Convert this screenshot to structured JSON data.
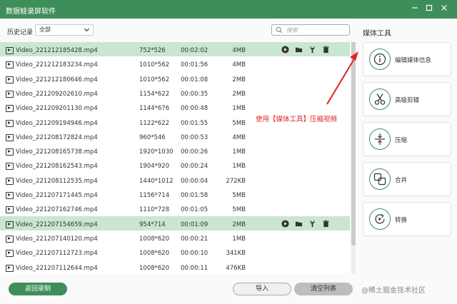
{
  "window": {
    "title": "数据蛙录屏软件",
    "controls": [
      "minimize",
      "maximize",
      "close"
    ]
  },
  "toolbar": {
    "history_label": "历史记录",
    "history_filter": "全部",
    "search_placeholder": "搜索"
  },
  "side_panel": {
    "title": "媒体工具",
    "tools": [
      {
        "label": "编辑媒体信息",
        "icon": "info-icon"
      },
      {
        "label": "高级剪辑",
        "icon": "scissors-icon"
      },
      {
        "label": "压缩",
        "icon": "compress-icon"
      },
      {
        "label": "合并",
        "icon": "merge-icon"
      },
      {
        "label": "转换",
        "icon": "convert-icon"
      }
    ]
  },
  "annotation": "使用【媒体工具】压缩视频",
  "records": [
    {
      "name": "Video_221212185428.mp4",
      "resolution": "752*526",
      "duration": "00:02:02",
      "size": "4MB",
      "selected": true
    },
    {
      "name": "Video_221212183234.mp4",
      "resolution": "1010*562",
      "duration": "00:01:56",
      "size": "4MB",
      "selected": false
    },
    {
      "name": "Video_221212180646.mp4",
      "resolution": "1010*562",
      "duration": "00:01:08",
      "size": "2MB",
      "selected": false
    },
    {
      "name": "Video_221209202610.mp4",
      "resolution": "1154*622",
      "duration": "00:00:35",
      "size": "2MB",
      "selected": false
    },
    {
      "name": "Video_221209201130.mp4",
      "resolution": "1144*676",
      "duration": "00:00:48",
      "size": "1MB",
      "selected": false
    },
    {
      "name": "Video_221209194946.mp4",
      "resolution": "1122*622",
      "duration": "00:01:55",
      "size": "5MB",
      "selected": false
    },
    {
      "name": "Video_221208172824.mp4",
      "resolution": "960*546",
      "duration": "00:00:53",
      "size": "4MB",
      "selected": false
    },
    {
      "name": "Video_221208165738.mp4",
      "resolution": "1920*1030",
      "duration": "00:00:26",
      "size": "1MB",
      "selected": false
    },
    {
      "name": "Video_221208162543.mp4",
      "resolution": "1904*920",
      "duration": "00:00:24",
      "size": "1MB",
      "selected": false
    },
    {
      "name": "Video_221208112535.mp4",
      "resolution": "1440*1012",
      "duration": "00:00:04",
      "size": "272KB",
      "selected": false
    },
    {
      "name": "Video_221207171445.mp4",
      "resolution": "1156*714",
      "duration": "00:01:58",
      "size": "5MB",
      "selected": false
    },
    {
      "name": "Video_221207162746.mp4",
      "resolution": "1110*728",
      "duration": "00:01:05",
      "size": "5MB",
      "selected": false
    },
    {
      "name": "Video_221207154659.mp4",
      "resolution": "954*714",
      "duration": "00:01:09",
      "size": "2MB",
      "selected": true
    },
    {
      "name": "Video_221207140120.mp4",
      "resolution": "1008*620",
      "duration": "00:00:21",
      "size": "1MB",
      "selected": false
    },
    {
      "name": "Video_221207112723.mp4",
      "resolution": "1008*620",
      "duration": "00:00:10",
      "size": "341KB",
      "selected": false
    },
    {
      "name": "Video_221207112644.mp4",
      "resolution": "1008*620",
      "duration": "00:00:11",
      "size": "476KB",
      "selected": false
    }
  ],
  "row_actions": [
    "play-icon",
    "folder-icon",
    "tool-icon",
    "delete-icon"
  ],
  "footer": {
    "back_label": "返回录制",
    "import_label": "导入",
    "clear_label": "清空列表"
  },
  "watermark": "@稀土掘金技术社区",
  "colors": {
    "accent": "#3e8e5a",
    "selected_row": "#c9e6d2",
    "annotation": "#e02424"
  }
}
